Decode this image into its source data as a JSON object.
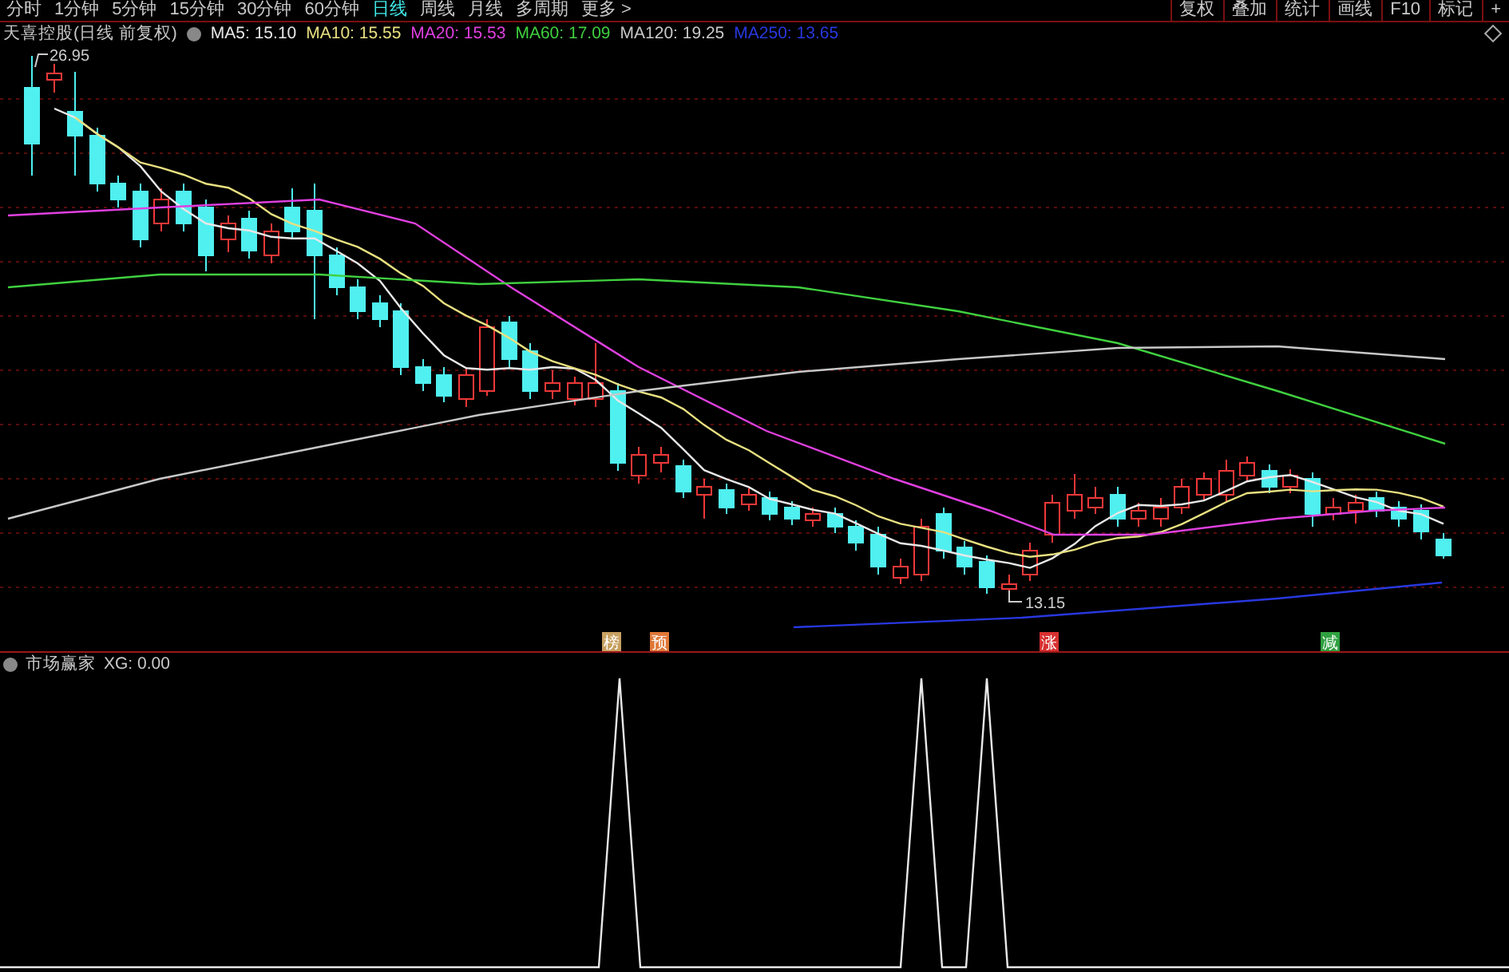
{
  "tabs": [
    {
      "label": "分时",
      "selected": false
    },
    {
      "label": "1分钟",
      "selected": false
    },
    {
      "label": "5分钟",
      "selected": false
    },
    {
      "label": "15分钟",
      "selected": false
    },
    {
      "label": "30分钟",
      "selected": false
    },
    {
      "label": "60分钟",
      "selected": false
    },
    {
      "label": "日线",
      "selected": true
    },
    {
      "label": "周线",
      "selected": false
    },
    {
      "label": "月线",
      "selected": false
    },
    {
      "label": "多周期",
      "selected": false
    },
    {
      "label": "更多 >",
      "selected": false
    }
  ],
  "tools": [
    "复权",
    "叠加",
    "统计",
    "画线",
    "F10",
    "标记",
    "+"
  ],
  "stock_title": "天喜控股(日线 前复权)",
  "legend": [
    {
      "label": "MA5: 15.10",
      "color": "#e8e8e8"
    },
    {
      "label": "MA10: 15.55",
      "color": "#e8e080"
    },
    {
      "label": "MA20: 15.53",
      "color": "#e040e0"
    },
    {
      "label": "MA60: 17.09",
      "color": "#40d040"
    },
    {
      "label": "MA120: 19.25",
      "color": "#c8c8c8"
    },
    {
      "label": "MA250: 13.65",
      "color": "#2838e0"
    }
  ],
  "price_labels": {
    "high": "26.95",
    "low": "13.15"
  },
  "markers": [
    {
      "label": "榜",
      "color": "#c8a060"
    },
    {
      "label": "预",
      "color": "#e07838"
    },
    {
      "label": "涨",
      "color": "#d83030"
    },
    {
      "label": "减",
      "color": "#30a040"
    }
  ],
  "indicator": {
    "name": "市场赢家",
    "reading": "XG: 0.00"
  }
}
